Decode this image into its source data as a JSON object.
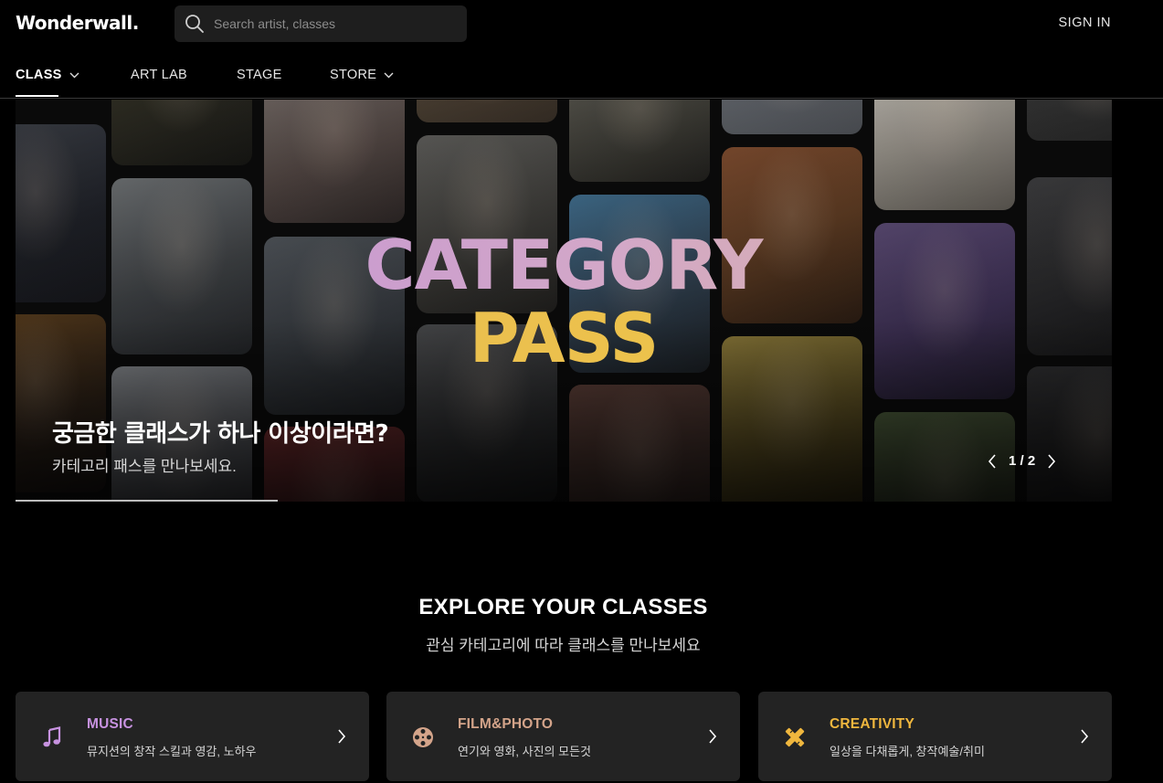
{
  "header": {
    "logo": "Wonderwall.",
    "search_placeholder": "Search artist, classes",
    "sign_in": "SIGN IN"
  },
  "nav": {
    "items": [
      {
        "label": "CLASS",
        "active": true,
        "dropdown": true
      },
      {
        "label": "ART LAB",
        "active": false,
        "dropdown": false
      },
      {
        "label": "STAGE",
        "active": false,
        "dropdown": false
      },
      {
        "label": "STORE",
        "active": false,
        "dropdown": true
      }
    ]
  },
  "hero": {
    "title_line1": "CATEGORY",
    "title_line2": "PASS",
    "heading": "궁금한 클래스가 하나 이상이라면?",
    "subheading": "카테고리 패스를 만나보세요.",
    "pager": "1 / 2",
    "current_slide": 1,
    "total_slides": 2
  },
  "explore": {
    "title": "EXPLORE YOUR CLASSES",
    "subtitle": "관심 카테고리에 따라 클래스를 만나보세요",
    "cards": [
      {
        "title": "MUSIC",
        "desc": "뮤지션의 창작 스킬과 영감, 노하우",
        "color": "#c792e0",
        "icon": "music-note-icon"
      },
      {
        "title": "FILM&PHOTO",
        "desc": "연기와 영화, 사진의 모든것",
        "color": "#d4a48a",
        "icon": "film-reel-icon"
      },
      {
        "title": "CREATIVITY",
        "desc": "일상을 다채롭게, 창작예술/취미",
        "color": "#f0b73e",
        "icon": "pencil-ruler-icon"
      }
    ]
  },
  "colors": {
    "background": "#000000",
    "card_bg": "#232323",
    "title_purple": "#c08fd6",
    "title_yellow": "#f2c744"
  }
}
